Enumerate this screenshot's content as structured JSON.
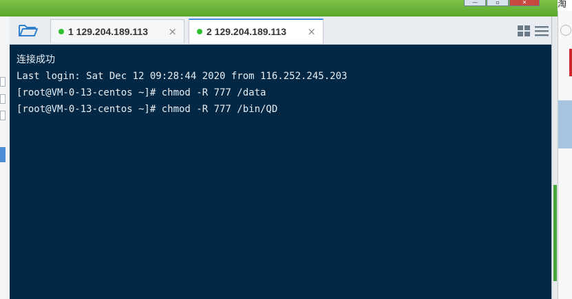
{
  "window": {
    "corner_char": "淘"
  },
  "tabs": [
    {
      "number": "1",
      "host": "129.204.189.113",
      "active": false
    },
    {
      "number": "2",
      "host": "129.204.189.113",
      "active": true
    }
  ],
  "tab_labels": {
    "tab1": "1 129.204.189.113",
    "tab2": "2 129.204.189.113"
  },
  "tab_close_glyph": "×",
  "icons": {
    "open": "folder-open-icon",
    "layout": "grid-layout-icon",
    "menu": "hamburger-menu-icon",
    "status": "connected-dot-icon"
  },
  "colors": {
    "terminal_bg": "#022845",
    "terminal_fg": "#e8eef3",
    "status_dot": "#2fbf2f",
    "active_tab_accent": "#3d8ee0",
    "window_frame": "#57a82c"
  },
  "terminal": {
    "lines": [
      "连接成功",
      "Last login: Sat Dec 12 09:28:44 2020 from 116.252.245.203",
      "[root@VM-0-13-centos ~]# chmod -R 777 /data",
      "[root@VM-0-13-centos ~]# chmod -R 777 /bin/QD"
    ]
  }
}
